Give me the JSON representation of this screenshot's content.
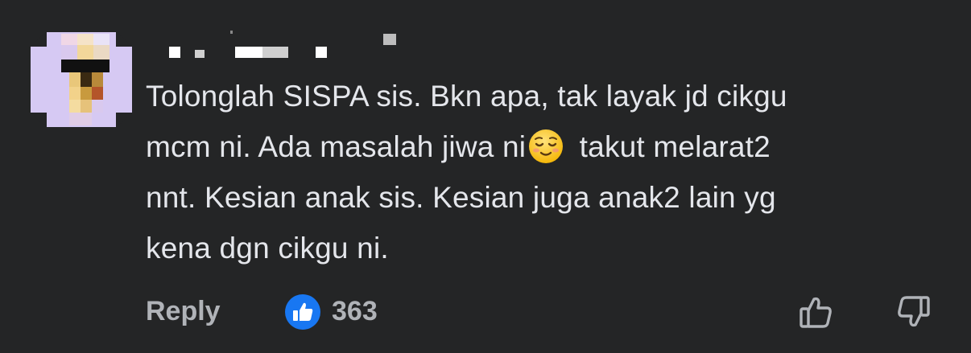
{
  "comment": {
    "author_avatar": "pixelated-avatar",
    "author_name": "",
    "lines": [
      "Tolonglah SISPA sis. Bkn apa, tak layak jd cikgu",
      "mcm ni. Ada masalah jiwa ni",
      " takut melarat2",
      "nnt. Kesian anak sis. Kesian juga anak2 lain yg",
      "kena dgn cikgu ni."
    ],
    "emoji": "relieved-face-emoji"
  },
  "actions": {
    "reply_label": "Reply",
    "like_icon": "like-badge-icon",
    "like_count": "363",
    "thumbs_up_icon": "thumbs-up-icon",
    "thumbs_down_icon": "thumbs-down-icon"
  },
  "colors": {
    "background": "#242526",
    "text": "#e4e6eb",
    "secondary_text": "#b0b3b8",
    "like_blue": "#1877f2"
  }
}
